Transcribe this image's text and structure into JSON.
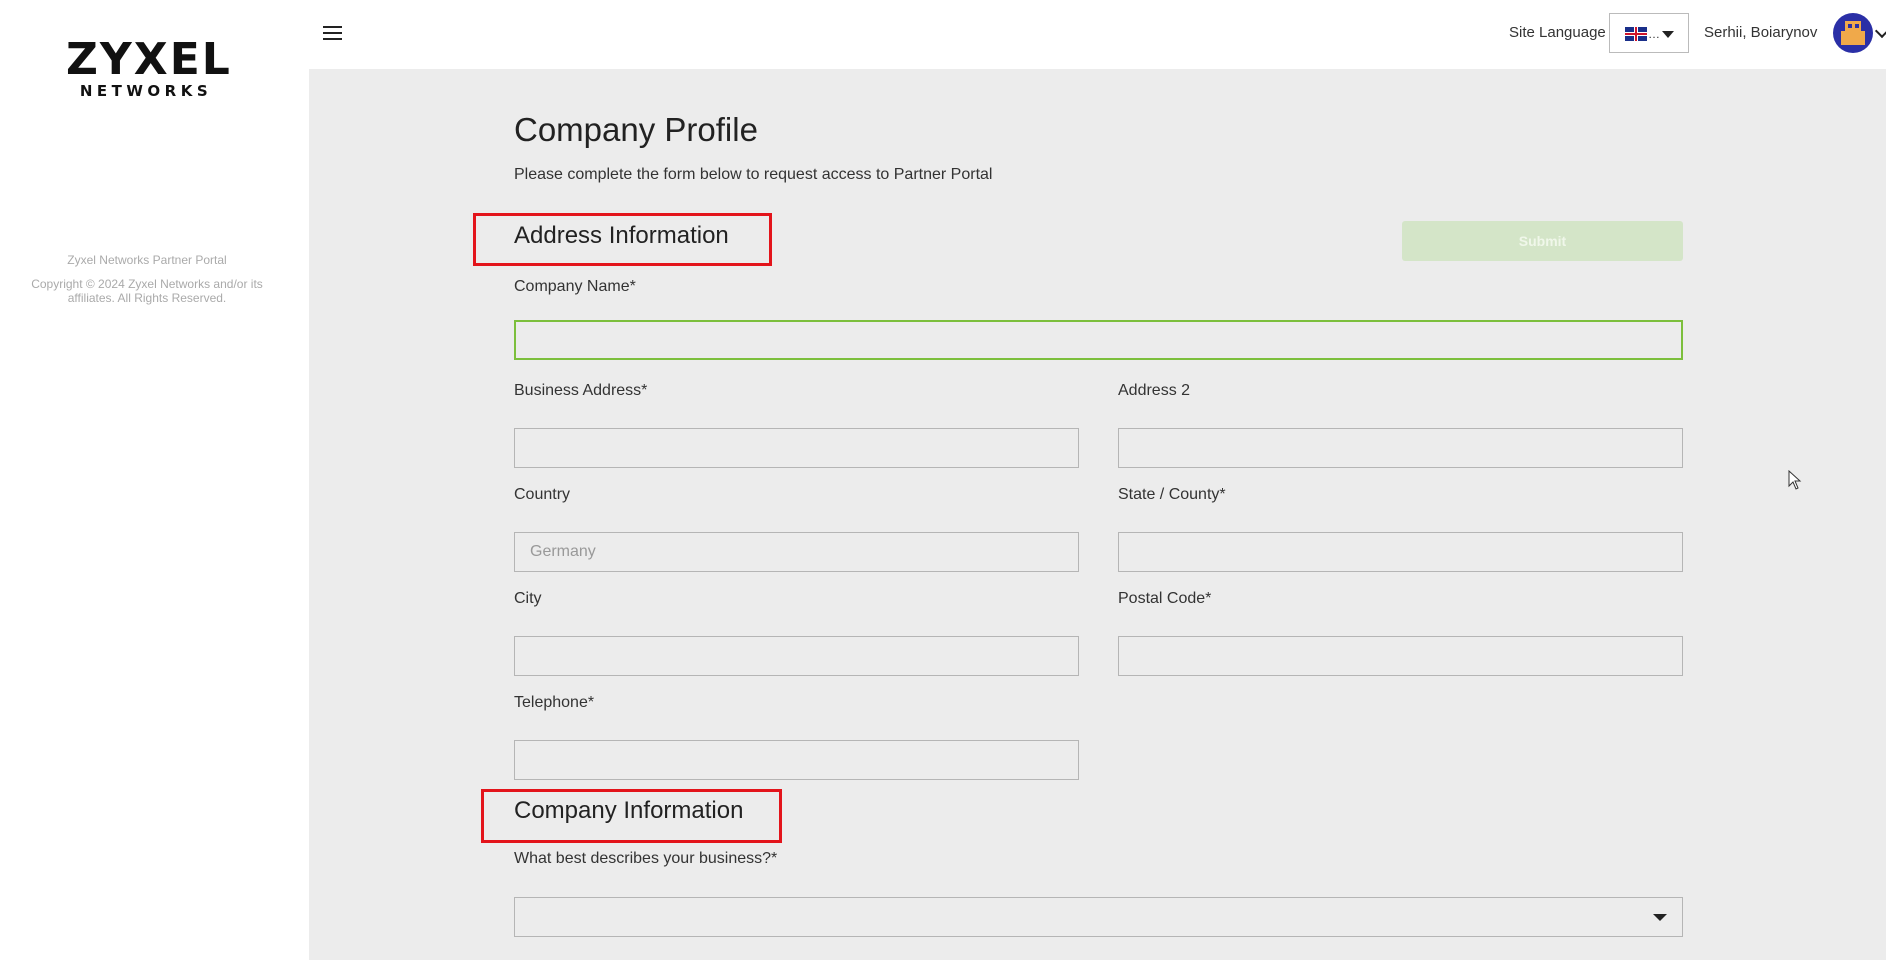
{
  "sidebar": {
    "logo_main": "ZYXEL",
    "logo_sub": "NETWORKS",
    "portal_name": "Zyxel Networks Partner Portal",
    "copyright": "Copyright © 2024 Zyxel Networks and/or its affiliates. All Rights Reserved."
  },
  "header": {
    "menu_icon": "hamburger-menu-icon",
    "site_language_label": "Site Language",
    "language_selected": "…",
    "language_flag": "uk-flag-icon",
    "user_name": "Serhii, Boiarynov",
    "avatar_icon": "pixel-avatar-icon"
  },
  "page": {
    "title": "Company Profile",
    "subtitle": "Please complete the form below to request access to Partner Portal",
    "submit_label": "Submit"
  },
  "address_section": {
    "title": "Address Information",
    "company_name_label": "Company Name*",
    "company_name_value": "",
    "business_address_label": "Business Address*",
    "business_address_value": "",
    "address2_label": "Address 2",
    "address2_value": "",
    "country_label": "Country",
    "country_value": "Germany",
    "state_label": "State / County*",
    "state_value": "",
    "city_label": "City",
    "city_value": "",
    "postal_code_label": "Postal Code*",
    "postal_code_value": "",
    "telephone_label": "Telephone*",
    "telephone_value": ""
  },
  "company_section": {
    "title": "Company Information",
    "business_type_label": "What best describes your business?*",
    "business_type_value": ""
  },
  "colors": {
    "highlight": "#e3141b",
    "accent_green": "#7cbf3c",
    "submit_disabled": "#d4e5c8",
    "main_bg": "#ececec"
  }
}
